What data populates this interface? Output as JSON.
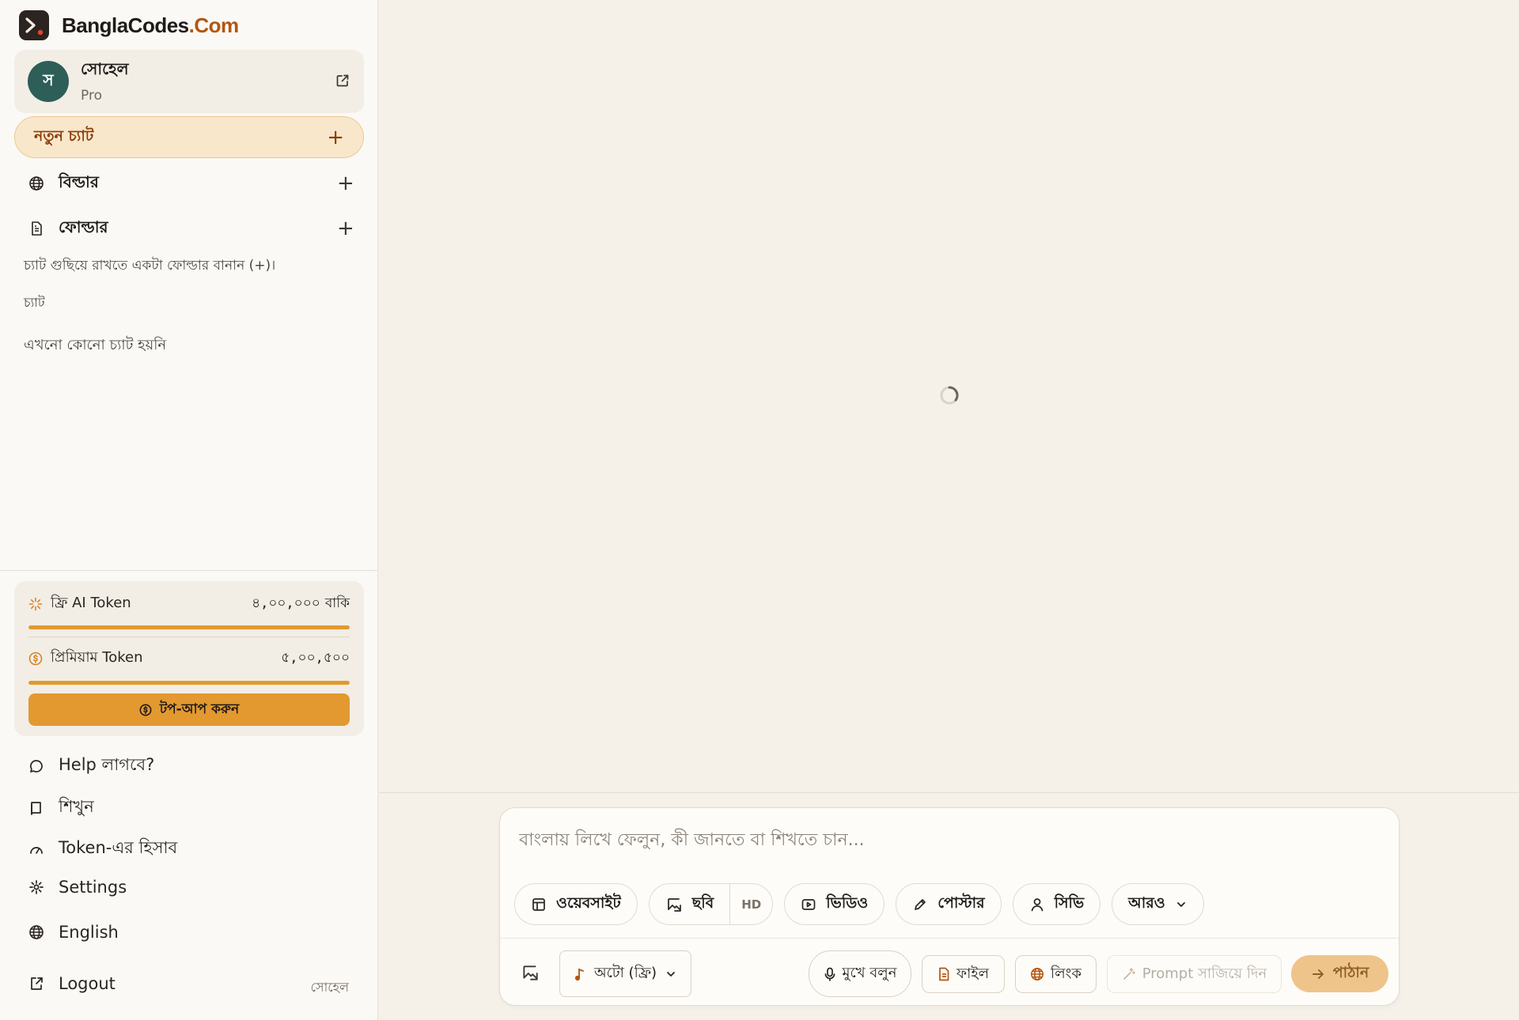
{
  "brand": {
    "name_main": "BanglaCodes",
    "name_suffix": ".Com",
    "accent": "#b3560f"
  },
  "profile": {
    "avatar_letter": "স",
    "name": "সোহেল",
    "plan": "Pro"
  },
  "new_chat": {
    "label": "নতুন চ্যাট",
    "plus": "+"
  },
  "sections": [
    {
      "label": "বিল্ডার",
      "icon": "globe-icon",
      "plus": "+"
    },
    {
      "label": "ফোল্ডার",
      "icon": "document-icon",
      "plus": "+"
    }
  ],
  "folder_hint": "চ্যাট গুছিয়ে রাখতে একটা ফোল্ডার বানান (+)।",
  "chats": {
    "heading": "চ্যাট",
    "empty": "এখনো কোনো চ্যাট হয়নি"
  },
  "tokens": {
    "free": {
      "label": "ফ্রি AI Token",
      "value": "৪,০০,০০০",
      "suffix": "বাকি",
      "progress": 1.0
    },
    "premium": {
      "label": "প্রিমিয়াম Token",
      "value": "৫,০০,৫০০",
      "progress": 1.0
    },
    "topup_label": "টপ-আপ করুন",
    "accent": "#e3992f"
  },
  "menu": [
    {
      "label": "Help লাগবে?",
      "icon": "chat-bubble-icon"
    },
    {
      "label": "শিখুন",
      "icon": "book-icon"
    },
    {
      "label": "Token-এর হিসাব",
      "icon": "gauge-icon"
    },
    {
      "label": "Settings",
      "icon": "gear-icon"
    },
    {
      "label": "English",
      "icon": "globe-icon"
    },
    {
      "label": "Logout",
      "icon": "logout-icon",
      "user": "সোহেল"
    }
  ],
  "composer": {
    "placeholder": "বাংলায় লিখে ফেলুন, কী জানতে বা শিখতে চান...",
    "chips": {
      "website": "ওয়েবসাইট",
      "image": "ছবি",
      "image_hd": "HD",
      "video": "ভিডিও",
      "poster": "পোস্টার",
      "cv": "সিভি",
      "more": "আরও"
    },
    "model": "অটো (ফ্রি)",
    "voice": "মুখে বলুন",
    "file": "ফাইল",
    "link": "লিংক",
    "prompt_helper": "Prompt সাজিয়ে দিন",
    "send": "পাঠান"
  }
}
